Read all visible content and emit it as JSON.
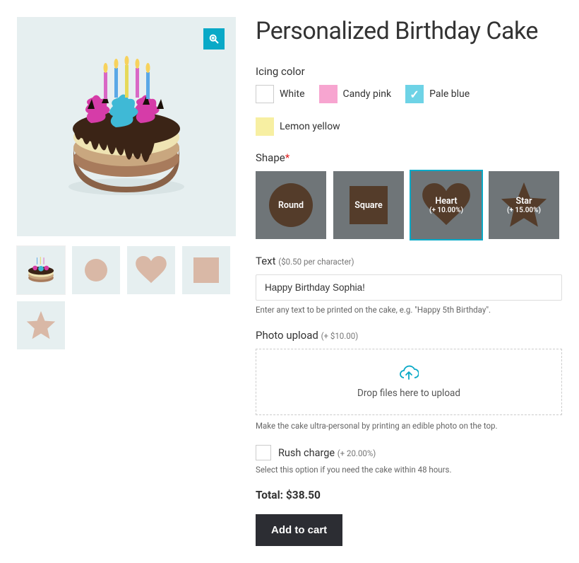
{
  "product": {
    "title": "Personalized Birthday Cake"
  },
  "icing": {
    "label": "Icing color",
    "options": [
      {
        "name": "White",
        "class": "white",
        "selected": false
      },
      {
        "name": "Candy pink",
        "class": "pink",
        "selected": false
      },
      {
        "name": "Pale blue",
        "class": "blue",
        "selected": true
      },
      {
        "name": "Lemon yellow",
        "class": "yellow",
        "selected": false
      }
    ]
  },
  "shape": {
    "label": "Shape",
    "required": "*",
    "options": [
      {
        "name": "Round",
        "extra": "",
        "selected": false
      },
      {
        "name": "Square",
        "extra": "",
        "selected": false
      },
      {
        "name": "Heart",
        "extra": "(+ 10.00%)",
        "selected": true
      },
      {
        "name": "Star",
        "extra": "(+ 15.00%)",
        "selected": false
      }
    ]
  },
  "text": {
    "label": "Text",
    "price_note": "($0.50 per character)",
    "value": "Happy Birthday Sophia!",
    "helper": "Enter any text to be printed on the cake, e.g. \"Happy 5th Birthday\"."
  },
  "upload": {
    "label": "Photo upload",
    "price_note": "(+ $10.00)",
    "drop_text": "Drop files here to upload",
    "helper": "Make the cake ultra-personal by printing an edible photo on the top."
  },
  "rush": {
    "label": "Rush charge",
    "price_note": "(+ 20.00%)",
    "helper": "Select this option if you need the cake within 48 hours."
  },
  "total": {
    "label": "Total: $38.50"
  },
  "cart": {
    "label": "Add to cart"
  }
}
